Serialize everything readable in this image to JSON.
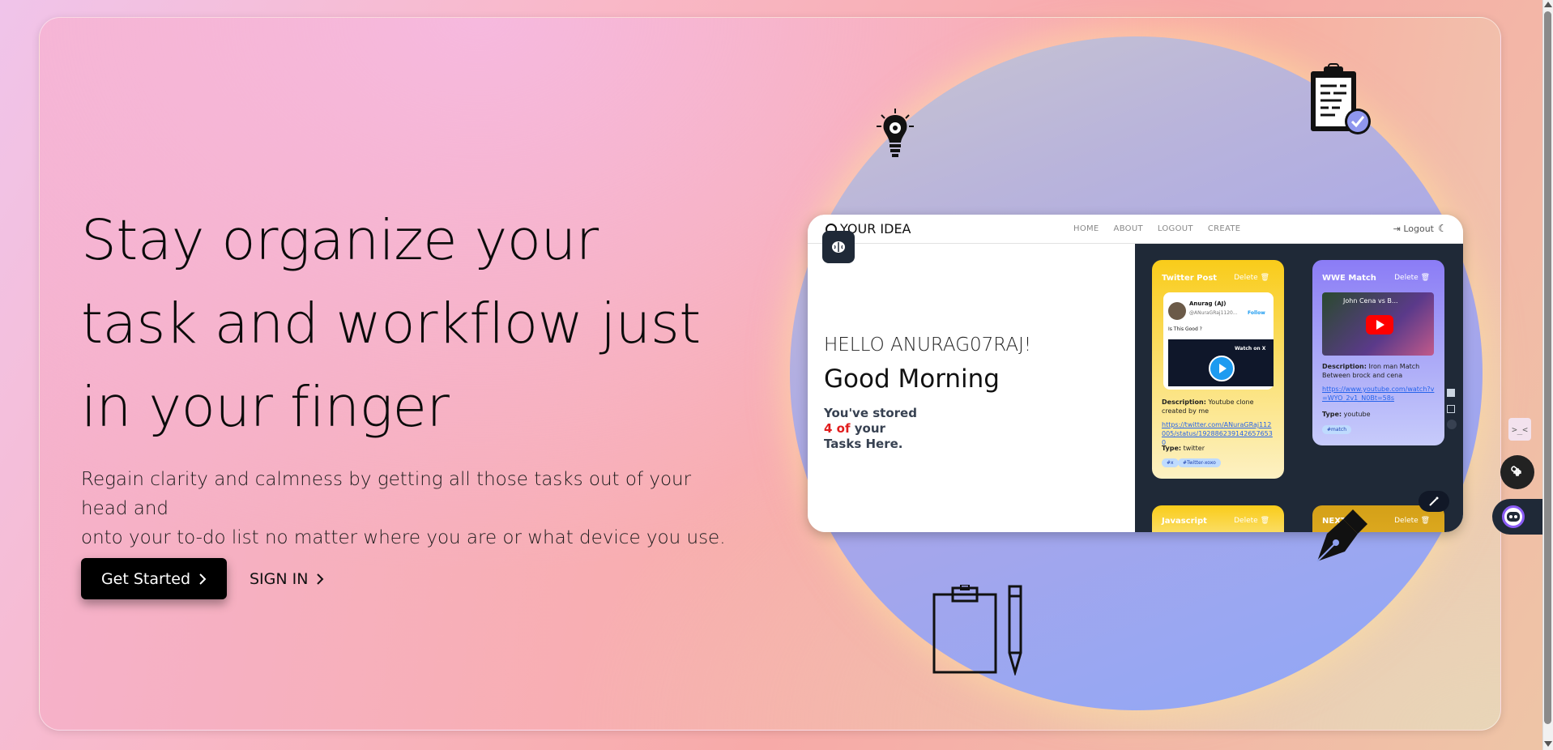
{
  "hero": {
    "headline_line1": "Stay organize your",
    "headline_line2": "task and workflow just",
    "headline_line3": "in your finger",
    "subtext_line1": "Regain clarity and calmness by getting all those tasks out of your head and",
    "subtext_line2": "onto your to-do list no matter where you are or what device you use.",
    "primary_button": "Get Started",
    "secondary_button": "SIGN IN"
  },
  "preview": {
    "brand": "YOUR IDEA",
    "nav_links": [
      "HOME",
      "ABOUT",
      "LOGOUT",
      "CREATE"
    ],
    "logout": "Logout",
    "hello": "HELLO ANURAG07RAJ!",
    "greeting": "Good Morning",
    "stored_prefix": "You've stored",
    "stored_count": "4 of",
    "stored_suffix": "your",
    "stored_line3": "Tasks Here.",
    "cards": [
      {
        "title": "Twitter Post",
        "delete": "Delete",
        "tweet_name": "Anurag (AJ)",
        "tweet_handle": "@ANuraGRaj1120...",
        "tweet_follow": "Follow",
        "tweet_text": "Is This Good ?",
        "tweet_watch": "Watch on X",
        "desc_label": "Description:",
        "desc": "Youtube clone created by me",
        "link": "https://twitter.com/ANuraGRaj112005/status/1928862391426576530",
        "type_label": "Type:",
        "type": "twitter",
        "tags": [
          "#x",
          "#Twitter-xoxo"
        ]
      },
      {
        "title": "WWE Match",
        "delete": "Delete",
        "video_title": "John Cena vs B...",
        "desc_label": "Description:",
        "desc": "Iron man Match Between brock and cena",
        "link": "https://www.youtube.com/watch?v=WYO_2v1_N0Bt=58s",
        "type_label": "Type:",
        "type": "youtube",
        "tags": [
          "#match"
        ]
      },
      {
        "title": "Javascript",
        "delete": "Delete"
      },
      {
        "title": "NEXT",
        "delete": "Delete"
      }
    ]
  },
  "icons": {
    "lightbulb": "lightbulb-gear-icon",
    "clipboard_check": "clipboard-check-icon",
    "clipboard_pencil": "clipboard-pencil-icon",
    "fountain_pen": "fountain-pen-icon"
  },
  "colors": {
    "accent_red": "#e11d1d",
    "button_black": "#000000",
    "preview_dark": "#1f2937",
    "card_yellow": "#f9cc1a",
    "card_purple": "#8b7cf6"
  }
}
